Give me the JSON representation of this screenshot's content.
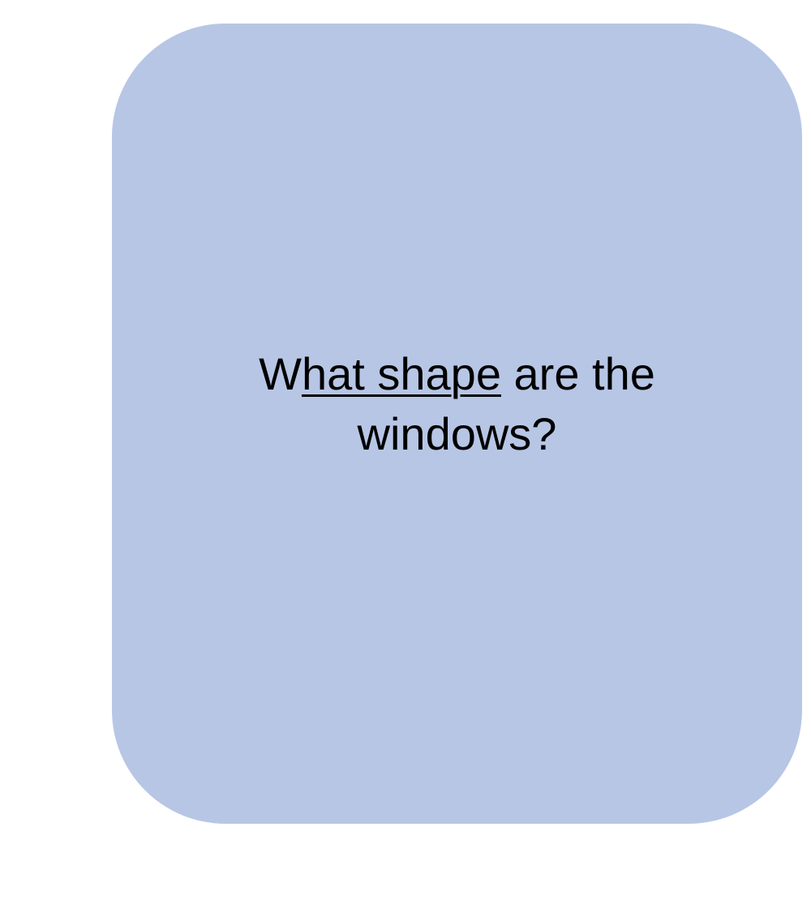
{
  "card": {
    "background_color": "#B7C6E5",
    "text_color": "#000000",
    "question": {
      "part1": "W",
      "part2_underlined": "hat shape",
      "part3": " are the windows?"
    }
  }
}
